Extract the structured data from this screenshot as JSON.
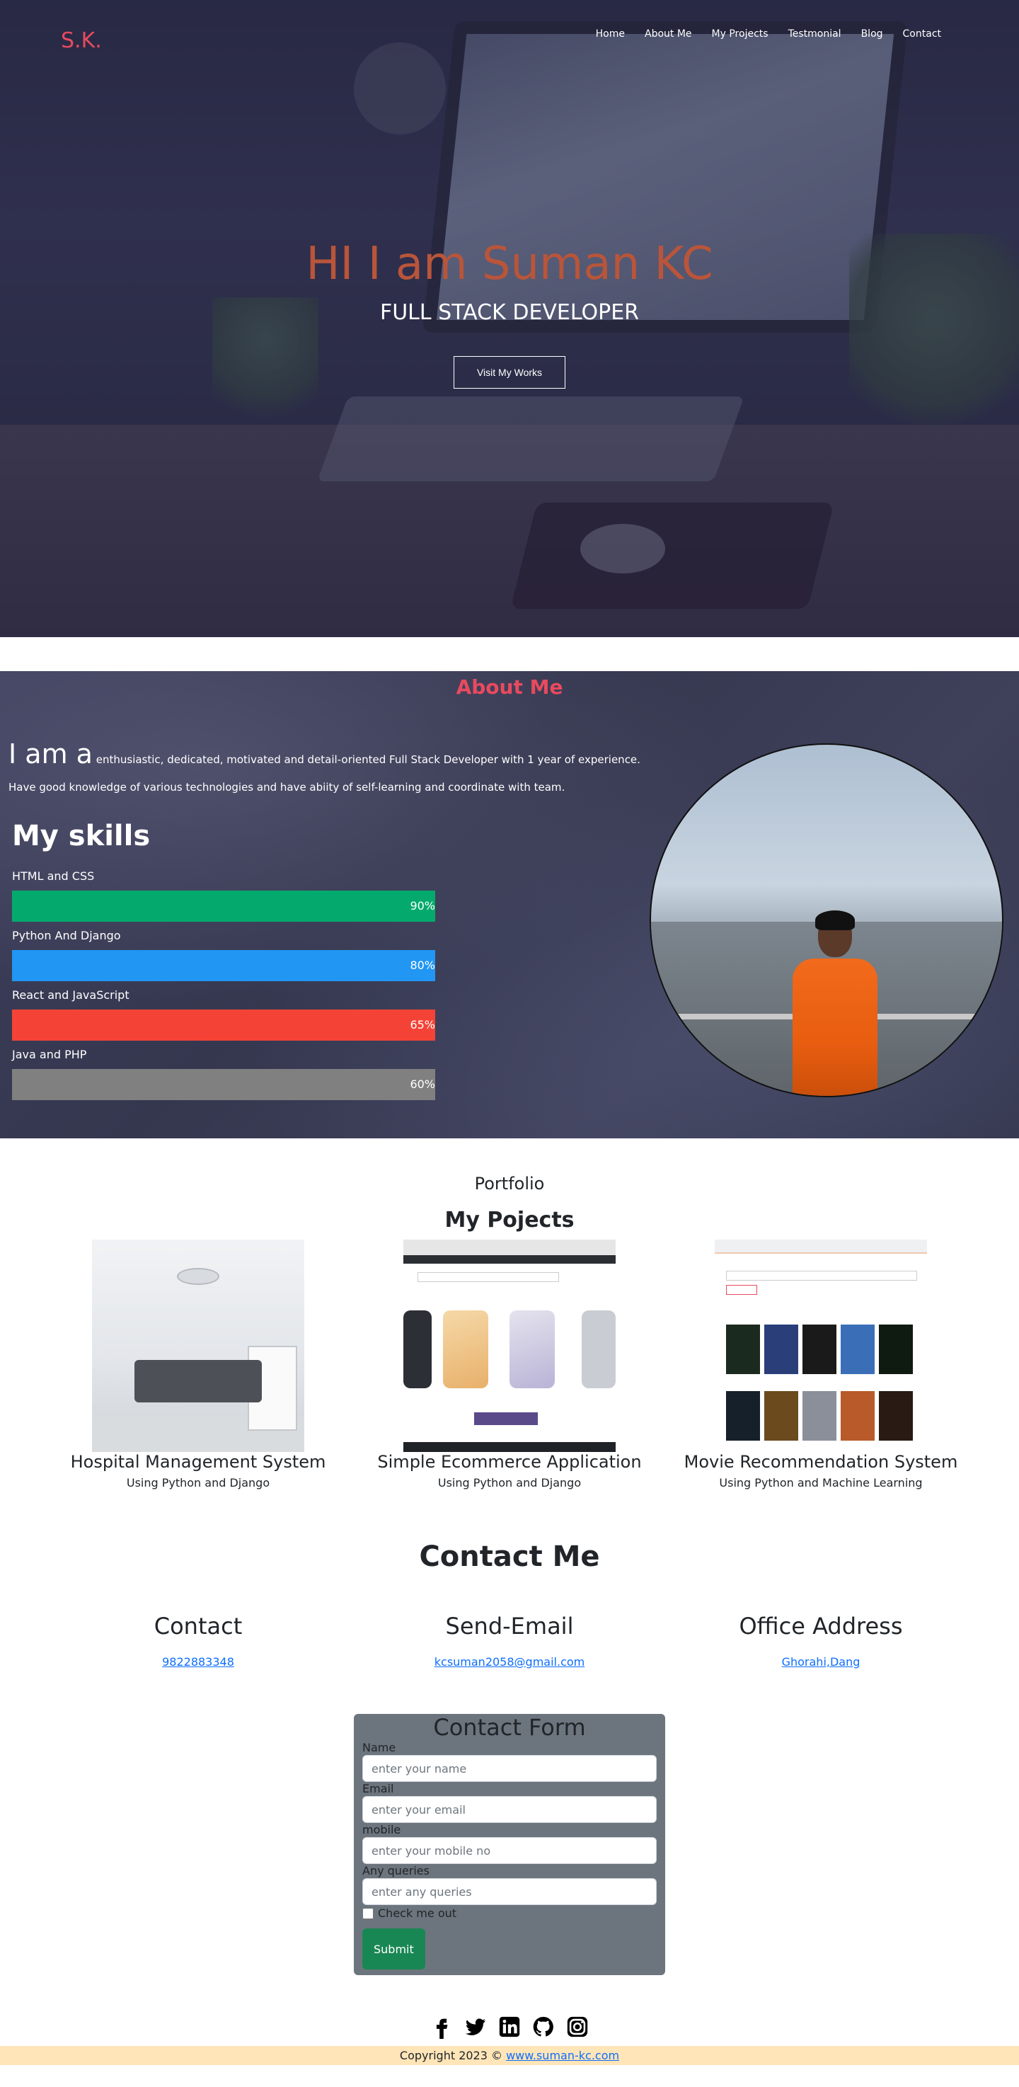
{
  "brand": "S.K.",
  "nav": {
    "items": [
      {
        "label": "Home"
      },
      {
        "label": "About Me"
      },
      {
        "label": "My Projects"
      },
      {
        "label": "Testmonial"
      },
      {
        "label": "Blog"
      },
      {
        "label": "Contact"
      }
    ]
  },
  "hero": {
    "title": "HI I am Suman KC",
    "subtitle": "FULL STACK DEVELOPER",
    "button_label": "Visit My Works"
  },
  "about": {
    "title": "About Me",
    "intro_lead": "I am a",
    "intro_text": "enthusiastic, dedicated, motivated and detail-oriented Full Stack Developer with 1 year of experience. Have good knowledge of various technologies and have abiity of self-learning and coordinate with team.",
    "skills_title": "My skills",
    "skills": [
      {
        "name": "HTML and CSS",
        "percent_label": "90%",
        "level": 100,
        "color": "#04aa6d"
      },
      {
        "name": "Python And Django",
        "percent_label": "80%",
        "level": 100,
        "color": "#2196f3"
      },
      {
        "name": "React and JavaScript",
        "percent_label": "65%",
        "level": 100,
        "color": "#f44336"
      },
      {
        "name": "Java and PHP",
        "percent_label": "60%",
        "level": 100,
        "color": "#808080"
      }
    ]
  },
  "portfolio": {
    "kicker": "Portfolio",
    "title": "My Pojects",
    "projects": [
      {
        "title": "Hospital Management System",
        "subtitle": "Using Python and Django"
      },
      {
        "title": "Simple Ecommerce Application",
        "subtitle": "Using Python and Django"
      },
      {
        "title": "Movie Recommendation System",
        "subtitle": "Using Python and Machine Learning"
      }
    ]
  },
  "contact": {
    "title": "Contact Me",
    "columns": [
      {
        "heading": "Contact",
        "link": "9822883348"
      },
      {
        "heading": "Send-Email",
        "link": "kcsuman2058@gmail.com"
      },
      {
        "heading": "Office Address",
        "link": "Ghorahi,Dang"
      }
    ]
  },
  "form": {
    "title": "Contact Form",
    "name_label": "Name",
    "name_placeholder": "enter your name",
    "email_label": "Email",
    "email_placeholder": "enter your email",
    "mobile_label": "mobile",
    "mobile_placeholder": "enter your mobile no",
    "queries_label": "Any queries",
    "queries_placeholder": "enter any queries",
    "check_label": "Check me out",
    "submit_label": "Submit"
  },
  "socials": [
    "facebook-icon",
    "twitter-icon",
    "linkedin-icon",
    "github-icon",
    "instagram-icon"
  ],
  "footer": {
    "copyright_text": "Copyright 2023 ©",
    "site_link": "www.suman-kc.com"
  },
  "colors": {
    "brand": "#e84a5f",
    "hero_title": "#b9553a",
    "submit": "#198754",
    "footer_bg": "#ffe5b8"
  }
}
